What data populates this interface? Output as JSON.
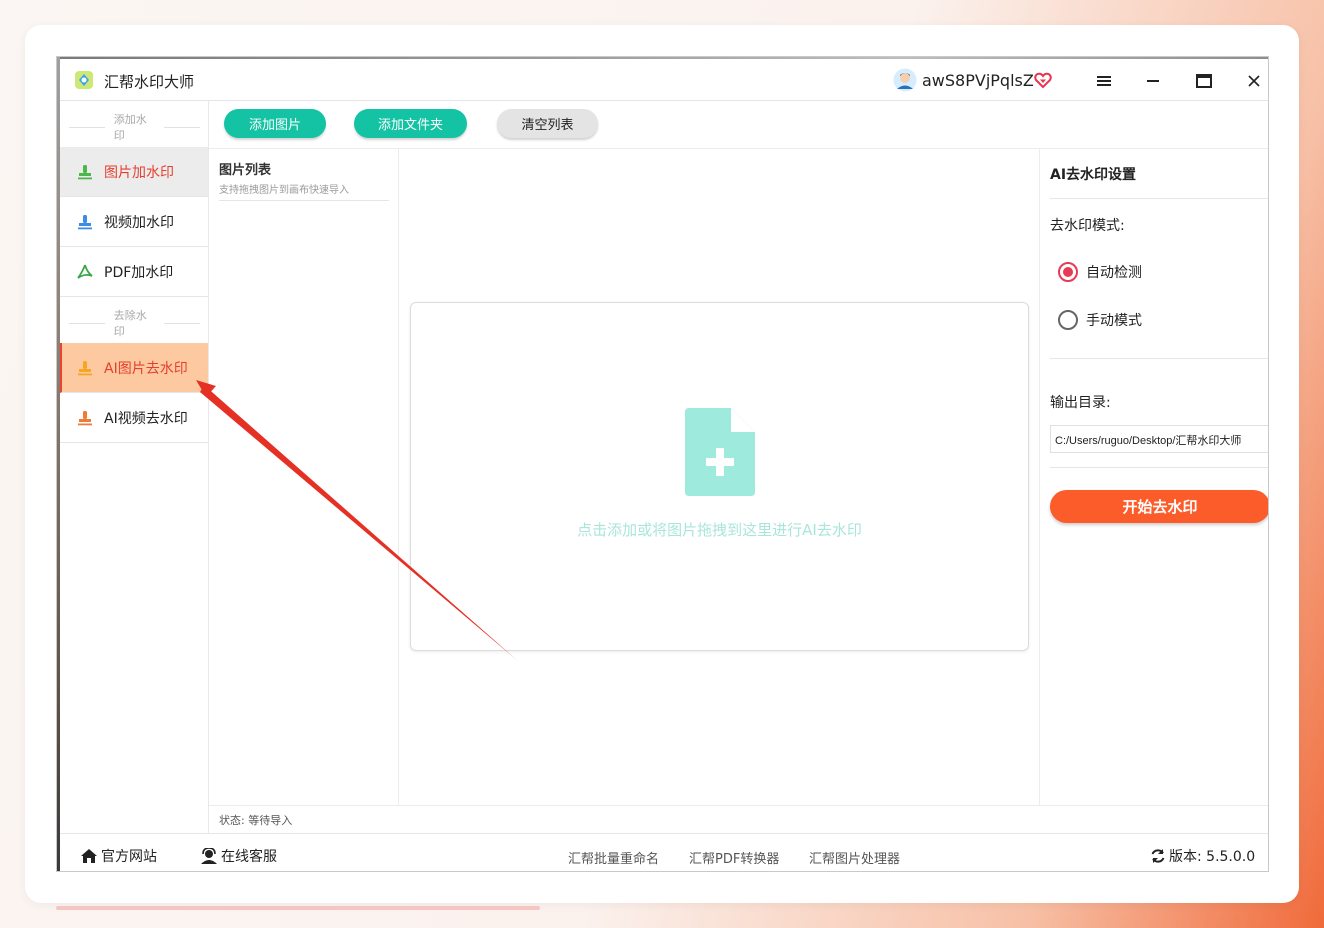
{
  "app": {
    "title": "汇帮水印大师",
    "username": "awS8PVjPqlsZ"
  },
  "sidebar": {
    "add_section": "添加水印",
    "remove_section": "去除水印",
    "items": [
      {
        "label": "图片加水印"
      },
      {
        "label": "视频加水印"
      },
      {
        "label": "PDF加水印"
      },
      {
        "label": "AI图片去水印"
      },
      {
        "label": "AI视频去水印"
      }
    ]
  },
  "toolbar": {
    "add_image": "添加图片",
    "add_folder": "添加文件夹",
    "clear_list": "清空列表"
  },
  "list": {
    "title": "图片列表",
    "subtitle": "支持拖拽图片到画布快速导入"
  },
  "drop_zone": {
    "hint": "点击添加或将图片拖拽到这里进行AI去水印"
  },
  "settings": {
    "title": "AI去水印设置",
    "mode_label": "去水印模式:",
    "modes": [
      {
        "label": "自动检测",
        "selected": true
      },
      {
        "label": "手动模式",
        "selected": false
      }
    ],
    "output_label": "输出目录:",
    "output_path": "C:/Users/ruguo/Desktop/汇帮水印大师",
    "start_button": "开始去水印"
  },
  "status": {
    "text": "状态: 等待导入"
  },
  "footer": {
    "website": "官方网站",
    "support": "在线客服",
    "links": [
      "汇帮批量重命名",
      "汇帮PDF转换器",
      "汇帮图片处理器"
    ],
    "version": "版本: 5.5.0.0"
  },
  "colors": {
    "accent_green": "#13c3a4",
    "accent_orange": "#fc5b2a",
    "active_red": "#e5402f",
    "annotation_arrow": "#e53124"
  }
}
